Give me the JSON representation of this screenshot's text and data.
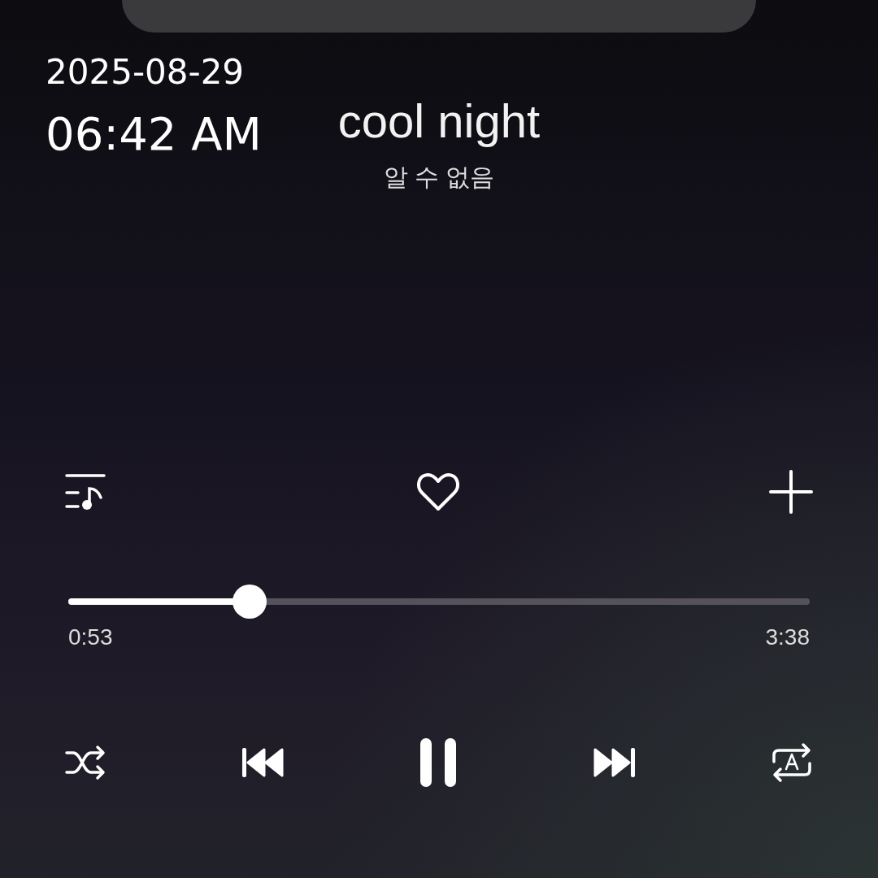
{
  "timestamp": {
    "date": "2025-08-29",
    "time": "06:42 AM"
  },
  "track": {
    "title": "cool night",
    "artist": "알 수 없음"
  },
  "actions": {
    "liked": false
  },
  "progress": {
    "level": 0.245,
    "elapsed": "0:53",
    "duration": "3:38"
  },
  "playback": {
    "playing": true
  }
}
